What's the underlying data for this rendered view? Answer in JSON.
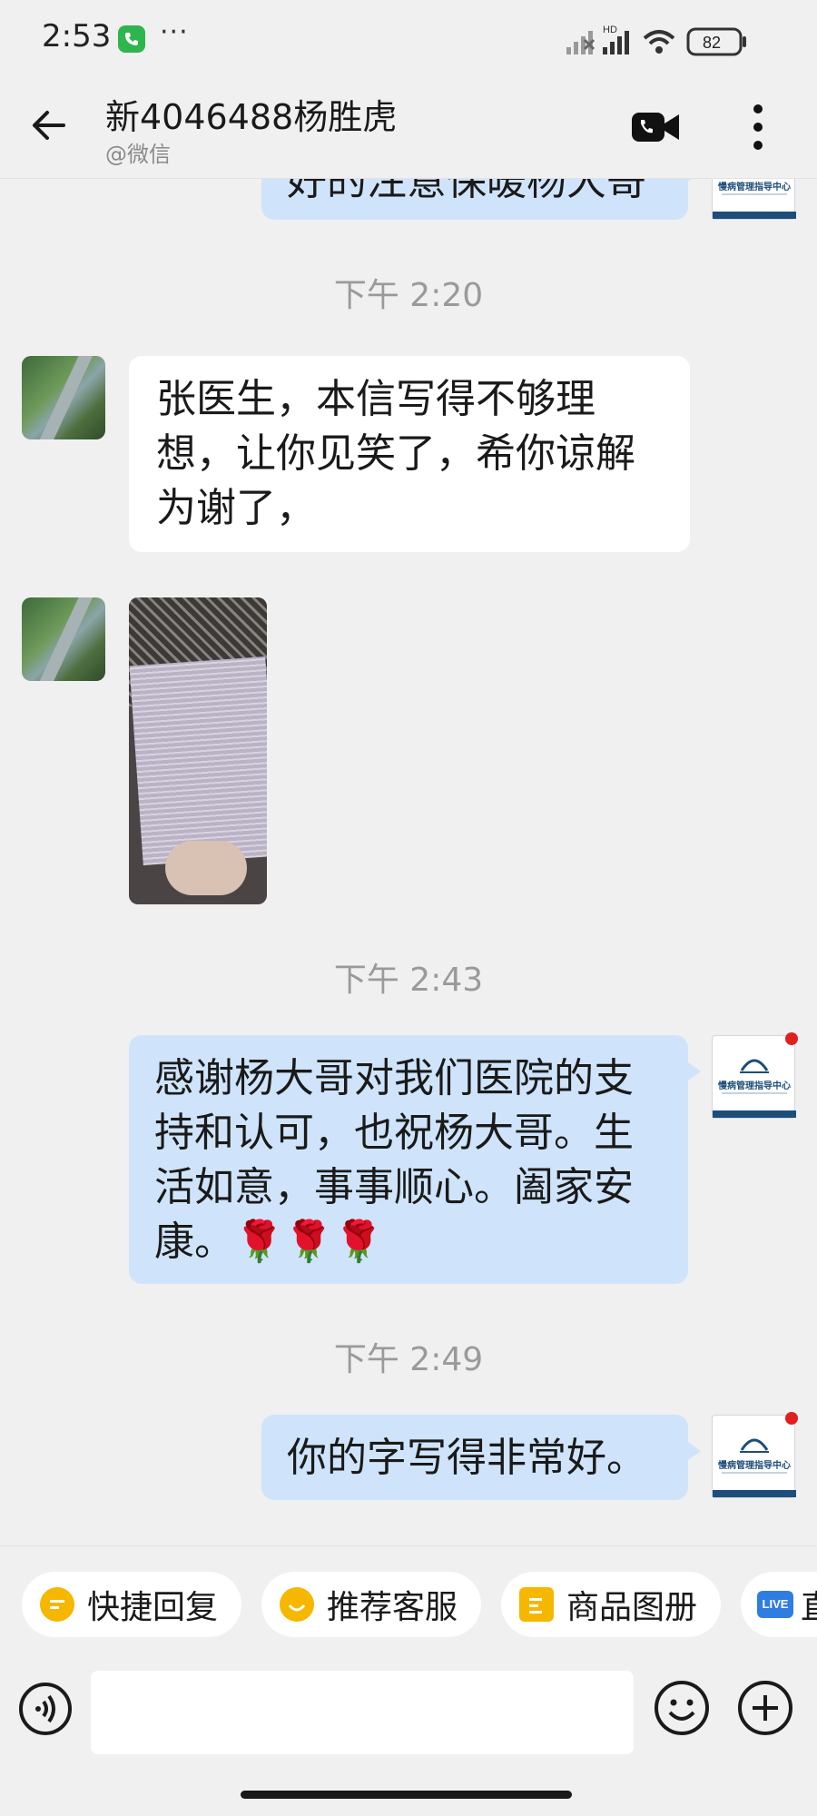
{
  "status_bar": {
    "time": "2:53",
    "more": "···",
    "network_tag": "HD",
    "battery": "82"
  },
  "header": {
    "title": "新4046488杨胜虎",
    "subtitle": "@微信",
    "icons": [
      "back-arrow-icon",
      "video-call-icon",
      "more-vertical-icon"
    ]
  },
  "chat": {
    "partial_message": "好的注意保暖杨大哥",
    "timestamps": [
      "下午 2:20",
      "下午 2:43",
      "下午 2:49"
    ],
    "messages": [
      {
        "side": "left",
        "text": "张医生，本信写得不够理想，让你见笑了，希你谅解为谢了，"
      },
      {
        "side": "left",
        "type": "image",
        "content": "photo-of-handwritten-letter"
      },
      {
        "side": "right",
        "text": "感谢杨大哥对我们医院的支持和认可，也祝杨大哥。生活如意，事事顺心。阖家安康。🌹🌹🌹"
      },
      {
        "side": "right",
        "text": "你的字写得非常好。"
      }
    ],
    "agent_avatar_label": "慢病管理指导中心"
  },
  "quick_actions": [
    {
      "label": "快捷回复",
      "icon": "quick-reply-icon",
      "color": "#f5b700"
    },
    {
      "label": "推荐客服",
      "icon": "service-icon",
      "color": "#f5b700"
    },
    {
      "label": "商品图册",
      "icon": "catalog-icon",
      "color": "#f5b700"
    },
    {
      "label": "直",
      "icon": "live-icon",
      "badge": "LIVE",
      "color": "#2f7de1"
    }
  ],
  "input_bar": {
    "placeholder": "",
    "icons": [
      "voice-icon",
      "emoji-icon",
      "plus-icon"
    ]
  }
}
